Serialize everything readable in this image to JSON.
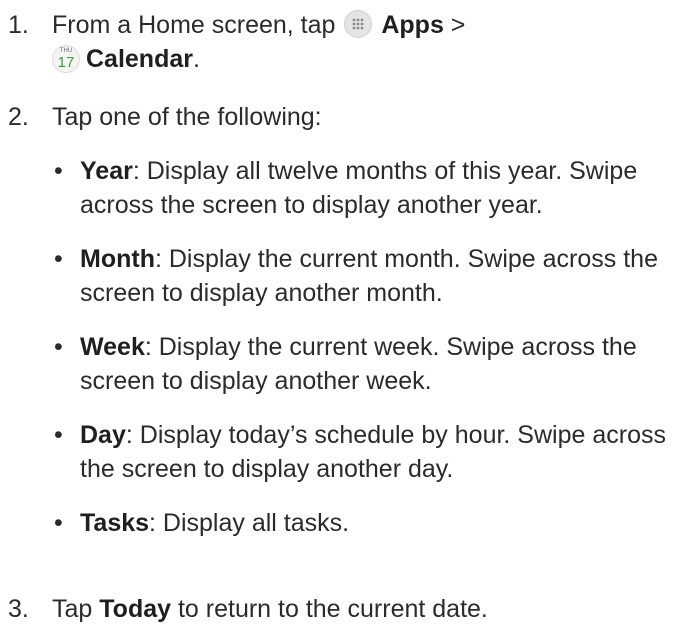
{
  "steps": {
    "s1": {
      "num": "1.",
      "text_a": "From a Home screen, tap ",
      "apps_label": "Apps",
      "gt": " >",
      "cal_icon_dow": "THU",
      "cal_icon_day": "17",
      "calendar_label": "Calendar",
      "period": "."
    },
    "s2": {
      "num": "2.",
      "text": "Tap one of the following:"
    },
    "options": [
      {
        "term": "Year",
        "desc": ": Display all twelve months of this year. Swipe across the screen to display another year."
      },
      {
        "term": "Month",
        "desc": ": Display the current month. Swipe across the screen to display another month."
      },
      {
        "term": "Week",
        "desc": ": Display the current week. Swipe across the screen to display another week."
      },
      {
        "term": "Day",
        "desc": ": Display today’s schedule by hour. Swipe across the screen to display another day."
      },
      {
        "term": "Tasks",
        "desc": ": Display all tasks."
      }
    ],
    "s3": {
      "num": "3.",
      "text_a": "Tap ",
      "today_label": "Today",
      "text_b": " to return to the current date."
    }
  },
  "icons": {
    "apps": "apps-grid-icon",
    "calendar": "calendar-app-icon"
  }
}
